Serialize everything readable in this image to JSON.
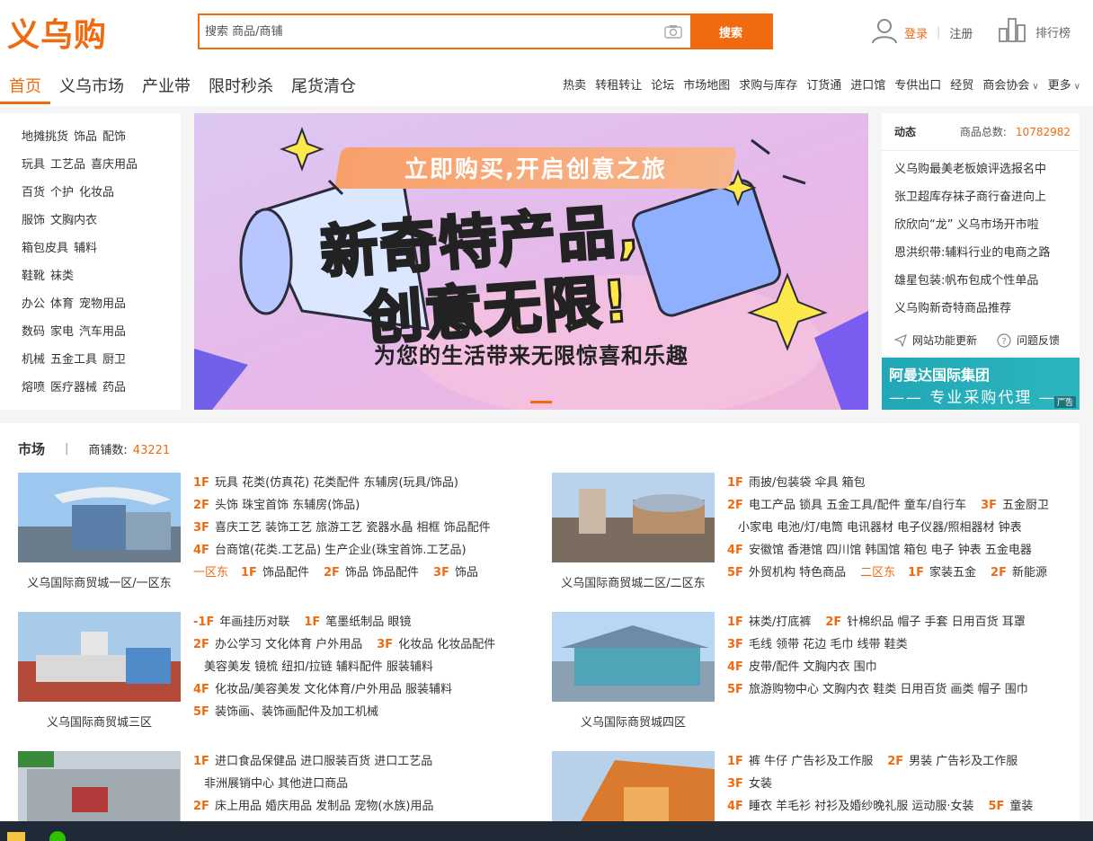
{
  "header": {
    "logo": "义乌购",
    "search_placeholder": "搜索 商品/商铺",
    "search_button": "搜索",
    "login": "登录",
    "register": "注册",
    "ranking": "排行榜"
  },
  "nav": {
    "main": [
      "首页",
      "义乌市场",
      "产业带",
      "限时秒杀",
      "尾货清仓"
    ],
    "sub": [
      "热卖",
      "转租转让",
      "论坛",
      "市场地图",
      "求购与库存",
      "订货通",
      "进口馆",
      "专供出口",
      "经贸",
      "商会协会",
      "更多"
    ]
  },
  "categories": [
    [
      "地摊挑货",
      "饰品",
      "配饰"
    ],
    [
      "玩具",
      "工艺品",
      "喜庆用品"
    ],
    [
      "百货",
      "个护",
      "化妆品"
    ],
    [
      "服饰",
      "文胸内衣"
    ],
    [
      "箱包皮具",
      "辅料"
    ],
    [
      "鞋靴",
      "袜类"
    ],
    [
      "办公",
      "体育",
      "宠物用品"
    ],
    [
      "数码",
      "家电",
      "汽车用品"
    ],
    [
      "机械",
      "五金工具",
      "厨卫"
    ],
    [
      "熔喷",
      "医疗器械",
      "药品"
    ]
  ],
  "banner": {
    "ribbon": "立即购买,开启创意之旅",
    "line1": "新奇特产品,",
    "line2": "创意无限!",
    "subtitle": "为您的生活带来无限惊喜和乐趣"
  },
  "news": {
    "title": "动态",
    "count_label": "商品总数:",
    "count": "10782982",
    "items": [
      "义乌购最美老板娘评选报名中",
      "张卫超库存袜子商行奋进向上",
      "欣欣向“龙” 义乌市场开市啦",
      "恩洪织带:辅料行业的电商之路",
      "雄星包装:帆布包成个性单品",
      "义乌购新奇特商品推荐"
    ],
    "footer": [
      "网站功能更新",
      "问题反馈"
    ]
  },
  "ad": {
    "line1": "阿曼达国际集团",
    "line2": "—— 专业采购代理 ——",
    "tag": "广告"
  },
  "market": {
    "title": "市场",
    "shop_label": "商铺数:",
    "shop_count": "43221",
    "blocks": [
      {
        "name": "义乌国际商贸城一区/一区东",
        "lines": [
          [
            {
              "f": "1F"
            },
            {
              "t": "玩具 花类(仿真花) 花类配件 东辅房(玩具/饰品)"
            }
          ],
          [
            {
              "f": "2F"
            },
            {
              "t": "头饰 珠宝首饰 东辅房(饰品)"
            }
          ],
          [
            {
              "f": "3F"
            },
            {
              "t": "喜庆工艺 装饰工艺 旅游工艺 瓷器水晶 相框 饰品配件"
            }
          ],
          [
            {
              "f": "4F"
            },
            {
              "t": "台商馆(花类.工艺品) 生产企业(珠宝首饰.工艺品)"
            }
          ],
          [
            {
              "z": "一区东"
            },
            {
              "f": "1F"
            },
            {
              "g": "饰品配件"
            },
            {
              "f": "2F"
            },
            {
              "g": "饰品 饰品配件"
            },
            {
              "f": "3F"
            },
            {
              "t": "饰品"
            }
          ]
        ]
      },
      {
        "name": "义乌国际商贸城二区/二区东",
        "lines": [
          [
            {
              "f": "1F"
            },
            {
              "t": "雨披/包装袋 伞具 箱包"
            }
          ],
          [
            {
              "f": "2F"
            },
            {
              "g": "电工产品 锁具 五金工具/配件 童车/自行车"
            },
            {
              "f": "3F"
            },
            {
              "t": "五金厨卫"
            }
          ],
          [
            {
              "ind": true,
              "t": "小家电 电池/灯/电筒 电讯器材 电子仪器/照相器材 钟表"
            }
          ],
          [
            {
              "f": "4F"
            },
            {
              "t": "安徽馆 香港馆 四川馆 韩国馆 箱包 电子 钟表 五金电器"
            }
          ],
          [
            {
              "f": "5F"
            },
            {
              "g": "外贸机构 特色商品"
            },
            {
              "z": "二区东"
            },
            {
              "f": "1F"
            },
            {
              "g": "家装五金"
            },
            {
              "f": "2F"
            },
            {
              "t": "新能源"
            }
          ]
        ]
      },
      {
        "name": "义乌国际商贸城三区",
        "lines": [
          [
            {
              "f": "-1F"
            },
            {
              "g": "年画挂历对联"
            },
            {
              "f": "1F"
            },
            {
              "t": "笔墨纸制品 眼镜"
            }
          ],
          [
            {
              "f": "2F"
            },
            {
              "g": "办公学习 文化体育 户外用品"
            },
            {
              "f": "3F"
            },
            {
              "t": "化妆品 化妆品配件"
            }
          ],
          [
            {
              "ind": true,
              "t": "美容美发 镜梳 纽扣/拉链 辅料配件 服装辅料"
            }
          ],
          [
            {
              "f": "4F"
            },
            {
              "t": "化妆品/美容美发 文化体育/户外用品 服装辅料"
            }
          ],
          [
            {
              "f": "5F"
            },
            {
              "t": "装饰画、装饰画配件及加工机械"
            }
          ]
        ]
      },
      {
        "name": "义乌国际商贸城四区",
        "lines": [
          [
            {
              "f": "1F"
            },
            {
              "g": "袜类/打底裤"
            },
            {
              "f": "2F"
            },
            {
              "t": "针棉织品 帽子 手套 日用百货 耳罩"
            }
          ],
          [
            {
              "f": "3F"
            },
            {
              "t": "毛线 领带 花边 毛巾 线带 鞋类"
            }
          ],
          [
            {
              "f": "4F"
            },
            {
              "t": "皮带/配件 文胸内衣 围巾"
            }
          ],
          [
            {
              "f": "5F"
            },
            {
              "t": "旅游购物中心 文胸内衣 鞋类 日用百货 画类 帽子 围巾"
            }
          ]
        ]
      },
      {
        "name": "",
        "lines": [
          [
            {
              "f": "1F"
            },
            {
              "t": "进口食品保健品 进口服装百货 进口工艺品"
            }
          ],
          [
            {
              "ind": true,
              "t": "非洲展销中心 其他进口商品"
            }
          ],
          [
            {
              "f": "2F"
            },
            {
              "t": "床上用品 婚庆用品 发制品 宠物(水族)用品"
            }
          ]
        ]
      },
      {
        "name": "",
        "lines": [
          [
            {
              "f": "1F"
            },
            {
              "g": "裤 牛仔 广告衫及工作服"
            },
            {
              "f": "2F"
            },
            {
              "t": "男装 广告衫及工作服"
            }
          ],
          [
            {
              "f": "3F"
            },
            {
              "t": "女装"
            }
          ],
          [
            {
              "f": "4F"
            },
            {
              "g": "睡衣 羊毛衫 衬衫及婚纱晚礼服 运动服·女装"
            },
            {
              "f": "5F"
            },
            {
              "t": "童装"
            }
          ]
        ]
      }
    ]
  },
  "colors": {
    "accent": "#f26a10"
  }
}
